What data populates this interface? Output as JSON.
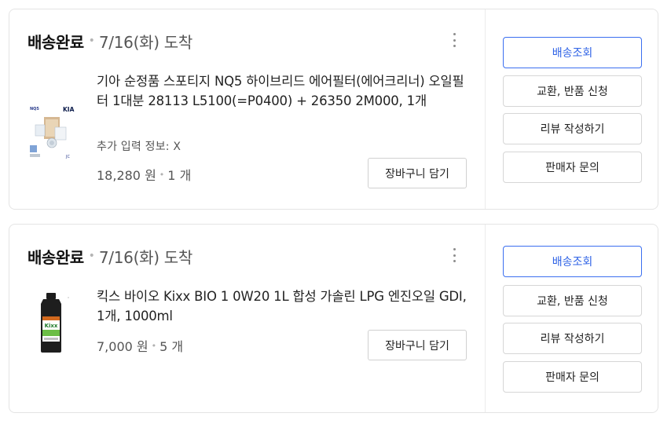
{
  "orders": [
    {
      "status": "배송완료",
      "arrival": "7/16(화) 도착",
      "product_title": "기아 순정품 스포티지 NQ5 하이브리드 에어필터(에어크리너) 오일필터 1대분 28113 L5100(=P0400) + 26350 2M000, 1개",
      "extra_info": "추가 입력 정보: X",
      "price": "18,280 원",
      "quantity": "1 개",
      "thumb_label": "NQ5",
      "thumb_brand": "KIA",
      "cart_label": "장바구니 담기",
      "actions": [
        "배송조회",
        "교환, 반품 신청",
        "리뷰 작성하기",
        "판매자 문의"
      ]
    },
    {
      "status": "배송완료",
      "arrival": "7/16(화) 도착",
      "product_title": "킥스 바이오 Kixx BIO 1 0W20 1L 합성 가솔린 LPG 엔진오일 GDI, 1개, 1000ml",
      "price": "7,000 원",
      "quantity": "5 개",
      "thumb_brand": "Kixx",
      "cart_label": "장바구니 담기",
      "actions": [
        "배송조회",
        "교환, 반품 신청",
        "리뷰 작성하기",
        "판매자 문의"
      ]
    }
  ],
  "colors": {
    "primary": "#2f63e6",
    "border": "#e4e4e4",
    "text": "#222222"
  },
  "icons": {
    "more": "kebab-menu-icon"
  }
}
